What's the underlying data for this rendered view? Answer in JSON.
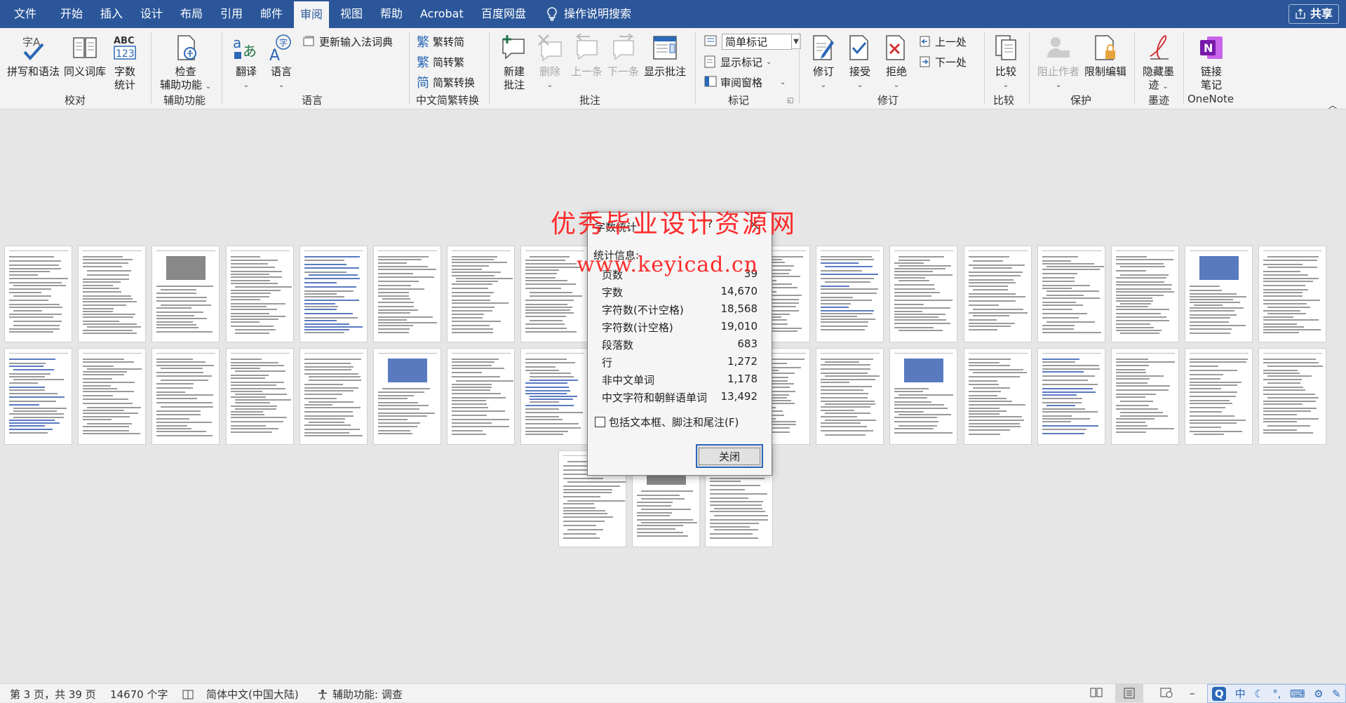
{
  "menubar": {
    "tabs": [
      "文件",
      "开始",
      "插入",
      "设计",
      "布局",
      "引用",
      "邮件",
      "审阅",
      "视图",
      "帮助",
      "Acrobat",
      "百度网盘"
    ],
    "active_tab": "审阅",
    "search": "操作说明搜索",
    "share": "共享"
  },
  "ribbon": {
    "proof": {
      "spelling": "拼写和语法",
      "thesaurus": "同义词库",
      "wordcount_1": "字数",
      "wordcount_2": "统计",
      "group": "校对"
    },
    "access": {
      "check_1": "检查",
      "check_2": "辅助功能",
      "group": "辅助功能"
    },
    "language": {
      "translate": "翻译",
      "language": "语言",
      "update_ime": "更新输入法词典",
      "group": "语言"
    },
    "chinese": {
      "to_trad": "繁转简",
      "to_simp": "简转繁",
      "convert": "简繁转换",
      "group": "中文简繁转换"
    },
    "comments": {
      "new_1": "新建",
      "new_2": "批注",
      "delete": "删除",
      "prev": "上一条",
      "next": "下一条",
      "show": "显示批注",
      "group": "批注"
    },
    "tracking": {
      "markup_select": "简单标记",
      "show_markup": "显示标记",
      "review_pane": "审阅窗格",
      "group": "标记"
    },
    "changes": {
      "track": "修订",
      "accept": "接受",
      "reject": "拒绝",
      "previous": "上一处",
      "next": "下一处",
      "group": "修订"
    },
    "compare": {
      "compare": "比较",
      "group": "比较"
    },
    "protect": {
      "block": "阻止作者",
      "restrict": "限制编辑",
      "group": "保护"
    },
    "ink": {
      "hide_1": "隐藏墨",
      "hide_2": "迹",
      "group": "墨迹"
    },
    "onenote": {
      "link_1": "链接",
      "link_2": "笔记",
      "group": "OneNote"
    }
  },
  "watermark": {
    "line1": "优秀毕业设计资源网",
    "line2": "www.keyicad.cn"
  },
  "dialog": {
    "title": "字数统计",
    "help": "?",
    "stat_title": "统计信息:",
    "rows": [
      {
        "label": "页数",
        "value": "39"
      },
      {
        "label": "字数",
        "value": "14,670"
      },
      {
        "label": "字符数(不计空格)",
        "value": "18,568"
      },
      {
        "label": "字符数(计空格)",
        "value": "19,010"
      },
      {
        "label": "段落数",
        "value": "683"
      },
      {
        "label": "行",
        "value": "1,272"
      },
      {
        "label": "非中文单词",
        "value": "1,178"
      },
      {
        "label": "中文字符和朝鲜语单词",
        "value": "13,492"
      }
    ],
    "checkbox": "包括文本框、脚注和尾注(F)",
    "close_button": "关闭"
  },
  "status": {
    "page": "第 3 页，共 39 页",
    "words": "14670 个字",
    "lang": "简体中文(中国大陆)",
    "access": "辅助功能: 调查"
  },
  "ime": {
    "mode": "中"
  },
  "colors": {
    "brand": "#2b579a",
    "watermark": "#ff2b2b"
  }
}
